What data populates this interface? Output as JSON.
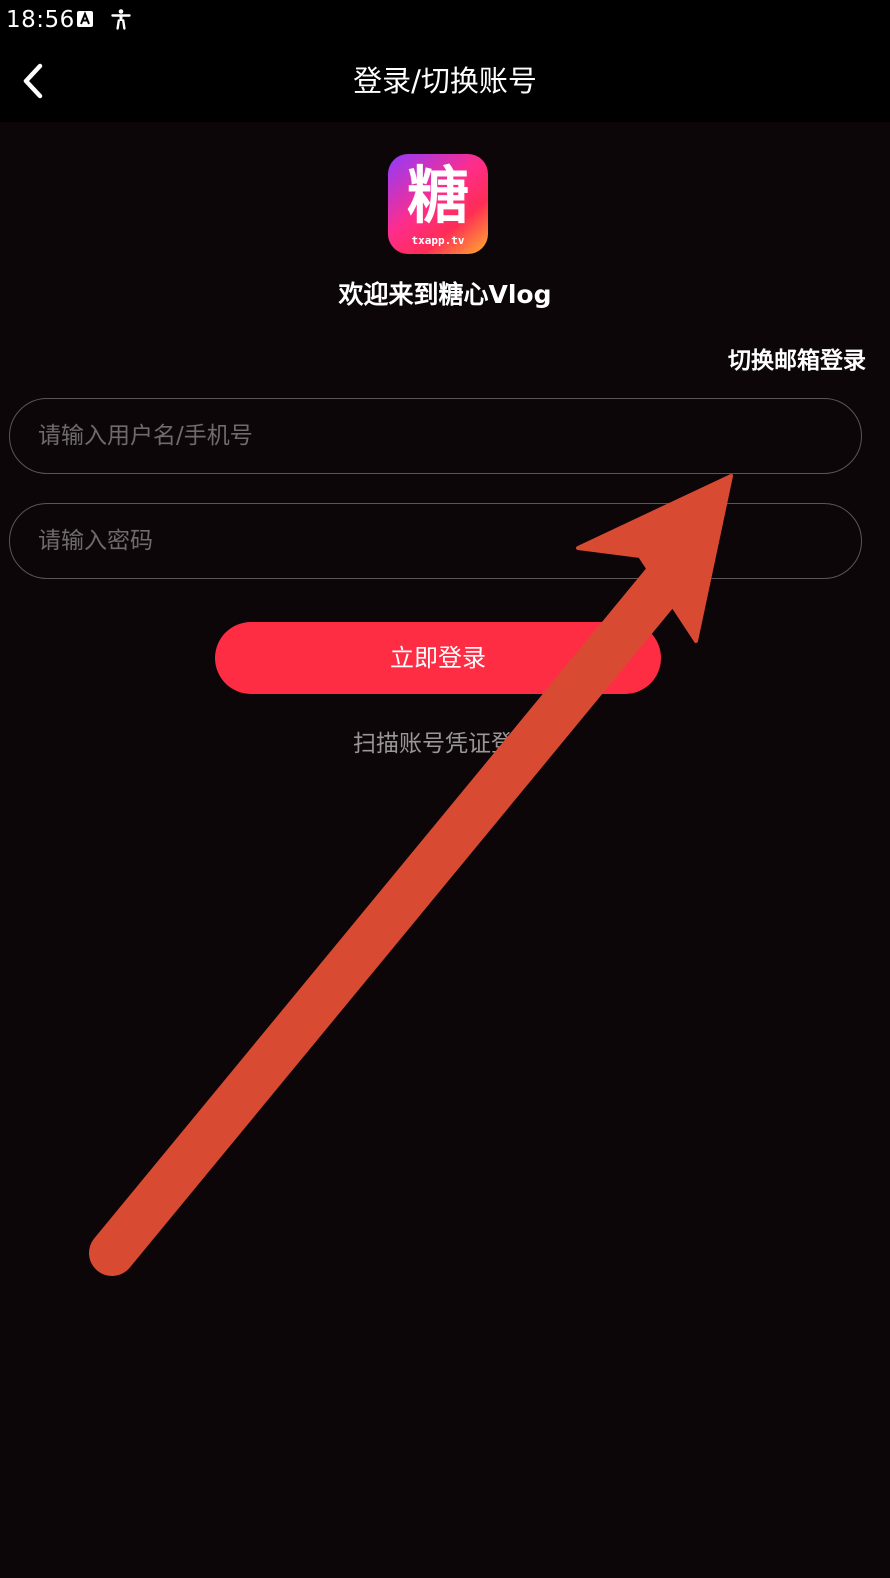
{
  "status_bar": {
    "time": "18:56",
    "icons": [
      "a-badge-icon",
      "accessibility-icon"
    ]
  },
  "header": {
    "title": "登录/切换账号",
    "back_icon": "chevron-left-icon"
  },
  "logo": {
    "char": "糖",
    "subtitle": "txapp.tv"
  },
  "welcome_text": "欢迎来到糖心Vlog",
  "switch_email_label": "切换邮箱登录",
  "username_field": {
    "placeholder": "请输入用户名/手机号",
    "value": ""
  },
  "password_field": {
    "placeholder": "请输入密码",
    "value": ""
  },
  "login_button_label": "立即登录",
  "scan_login_label": "扫描账号凭证登录",
  "colors": {
    "background": "#0c0608",
    "bar": "#000000",
    "accent": "#ff2d43",
    "field_border": "#5a5557",
    "placeholder": "#6f6a6c",
    "secondary_text": "#9a9597",
    "annotation_arrow": "#d94a33"
  }
}
